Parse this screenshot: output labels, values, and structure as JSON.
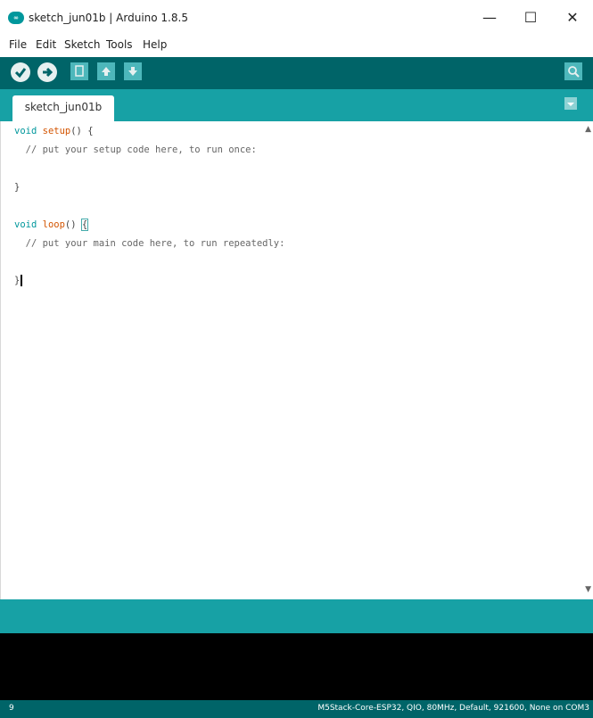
{
  "window": {
    "title": "sketch_jun01b | Arduino 1.8.5",
    "minimize_glyph": "—",
    "maximize_glyph": "☐",
    "close_glyph": "✕"
  },
  "menu": [
    {
      "label": "File"
    },
    {
      "label": "Edit"
    },
    {
      "label": "Sketch"
    },
    {
      "label": "Tools"
    },
    {
      "label": "Help"
    }
  ],
  "toolbar": {
    "icons": [
      "verify-icon",
      "upload-icon",
      "new-icon",
      "open-icon",
      "save-icon",
      "serial-monitor-icon"
    ]
  },
  "tabs": [
    {
      "label": "sketch_jun01b"
    }
  ],
  "code": {
    "kw_void": "void",
    "setup_fn": "setup",
    "setup_rest": "() {",
    "setup_comment": "  // put your setup code here, to run once:",
    "close_brace": "}",
    "loop_fn": "loop",
    "loop_parens": "() ",
    "open_brace": "{",
    "loop_comment": "  // put your main code here, to run repeatedly:"
  },
  "footer": {
    "line_number": "9",
    "board_info": "M5Stack-Core-ESP32, QIO, 80MHz, Default, 921600, None on COM3"
  },
  "colors": {
    "toolbar": "#006468",
    "tabbar": "#17a1a5",
    "keyword": "#00979c",
    "function": "#d35400"
  }
}
